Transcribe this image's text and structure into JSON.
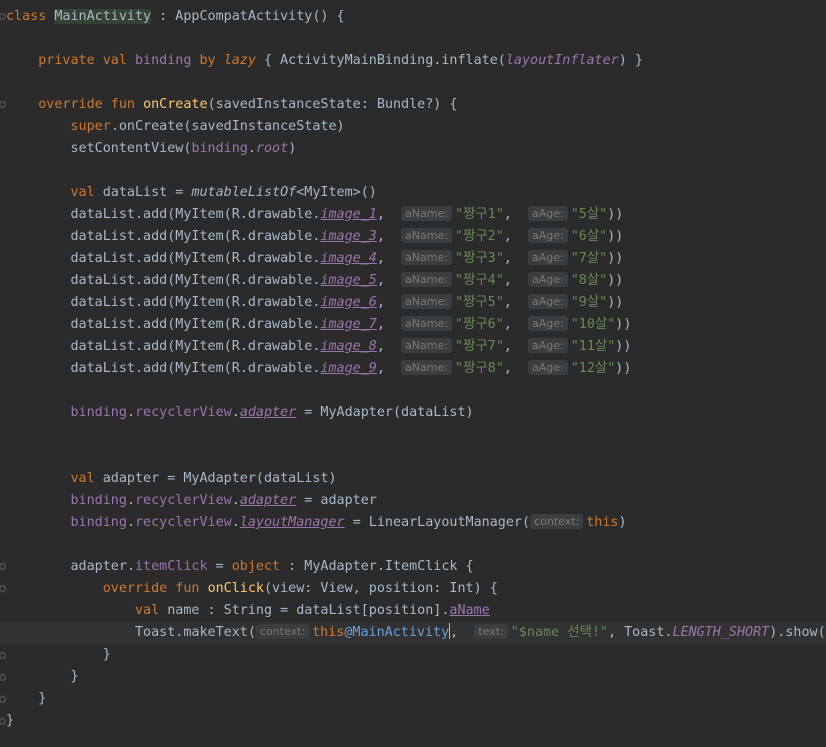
{
  "code": {
    "class_kw": "class",
    "class_name": "MainActivity",
    "class_rest": " : AppCompatActivity() {",
    "l_private": "private",
    "l_val": "val",
    "l_binding": "binding",
    "l_by": "by",
    "l_lazy": "lazy",
    "l_lazy_body": "{ ActivityMainBinding.inflate(",
    "l_layoutInflater": "layoutInflater",
    "l_lazy_end": ") }",
    "override": "override",
    "fun": "fun",
    "onCreate": "onCreate",
    "onCreate_params": "(savedInstanceState: Bundle?) {",
    "super": "super",
    "super_call": ".onCreate(savedInstanceState)",
    "setContentView": "setContentView(",
    "binding": "binding",
    "dot": ".",
    "root": "root",
    "close_paren": ")",
    "val": "val",
    "dataList_decl": " dataList = ",
    "mutableListOf": "mutableListOf",
    "mutable_rest": "<MyItem>()",
    "add_prefix": "dataList.add(MyItem(R.drawable.",
    "hint_aName": "aName:",
    "hint_aAge": "aAge:",
    "comma": ",",
    "items": [
      {
        "img": "image_1",
        "name": "\"짱구1\"",
        "age": "\"5살\""
      },
      {
        "img": "image_3",
        "name": "\"짱구2\"",
        "age": "\"6살\""
      },
      {
        "img": "image_4",
        "name": "\"짱구3\"",
        "age": "\"7살\""
      },
      {
        "img": "image_5",
        "name": "\"짱구4\"",
        "age": "\"8살\""
      },
      {
        "img": "image_6",
        "name": "\"짱구5\"",
        "age": "\"9살\""
      },
      {
        "img": "image_7",
        "name": "\"짱구6\"",
        "age": "\"10살\""
      },
      {
        "img": "image_8",
        "name": "\"짱구7\"",
        "age": "\"11살\""
      },
      {
        "img": "image_9",
        "name": "\"짱구8\"",
        "age": "\"12살\""
      }
    ],
    "add_end": "))",
    "recyclerView": "recyclerView",
    "adapter_prop": "adapter",
    "assign_adapter": " = MyAdapter(dataList)",
    "adapter_decl": " adapter = MyAdapter(dataList)",
    "assign_adapter_var": " = adapter",
    "layoutManager": "layoutManager",
    "assign_lm": " = LinearLayoutManager(",
    "hint_context": "context:",
    "this": "this",
    "adapter_var": "adapter",
    "itemClick": "itemClick",
    "eq": " = ",
    "object": "object",
    "itemclick_rest": " : MyAdapter.ItemClick {",
    "onClick": "onClick",
    "onClick_params": "(view: View, position: Int) {",
    "name_decl": " name : String = dataList[position].",
    "aName": "aName",
    "toast_start": "Toast.makeText(",
    "this_at": "this",
    "main_activity_label": "@MainActivity",
    "hint_text": "text:",
    "toast_str": "\"$name 선택!\"",
    "toast_mid": ", Toast.",
    "length_short": "LENGTH_SHORT",
    "toast_end": ").show()",
    "brace_close": "}"
  }
}
